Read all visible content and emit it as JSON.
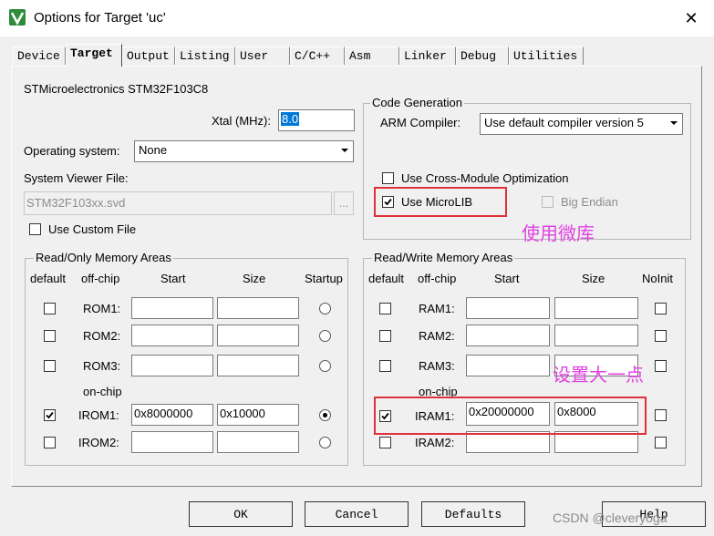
{
  "window": {
    "title": "Options for Target 'uc'",
    "close_glyph": "✕"
  },
  "tabs": [
    "Device",
    "Target",
    "Output",
    "Listing",
    "User",
    "C/C++",
    "Asm",
    "Linker",
    "Debug",
    "Utilities"
  ],
  "active_tab": "Target",
  "device": {
    "name": "STMicroelectronics STM32F103C8"
  },
  "xtal": {
    "label": "Xtal (MHz):",
    "value": "8.0"
  },
  "os": {
    "label": "Operating system:",
    "value": "None"
  },
  "svd": {
    "label": "System Viewer File:",
    "value": "STM32F103xx.svd",
    "browse_label": "..."
  },
  "custom_file": {
    "label": "Use Custom File",
    "checked": false
  },
  "code_gen": {
    "title": "Code Generation",
    "compiler_label": "ARM Compiler:",
    "compiler_value": "Use default compiler version 5",
    "cross_module": {
      "label": "Use Cross-Module Optimization",
      "checked": false
    },
    "microlib": {
      "label": "Use MicroLIB",
      "checked": true
    },
    "big_endian": {
      "label": "Big Endian",
      "checked": false
    }
  },
  "rom": {
    "title": "Read/Only Memory Areas",
    "headers": {
      "default": "default",
      "offchip": "off-chip",
      "start": "Start",
      "size": "Size",
      "startup": "Startup"
    },
    "onchip_label": "on-chip",
    "rows": [
      {
        "name": "ROM1:",
        "start": "",
        "size": "",
        "default": false,
        "startup": false
      },
      {
        "name": "ROM2:",
        "start": "",
        "size": "",
        "default": false,
        "startup": false
      },
      {
        "name": "ROM3:",
        "start": "",
        "size": "",
        "default": false,
        "startup": false
      },
      {
        "name": "IROM1:",
        "start": "0x8000000",
        "size": "0x10000",
        "default": true,
        "startup": true
      },
      {
        "name": "IROM2:",
        "start": "",
        "size": "",
        "default": false,
        "startup": false
      }
    ]
  },
  "ram": {
    "title": "Read/Write Memory Areas",
    "headers": {
      "default": "default",
      "offchip": "off-chip",
      "start": "Start",
      "size": "Size",
      "noinit": "NoInit"
    },
    "onchip_label": "on-chip",
    "rows": [
      {
        "name": "RAM1:",
        "start": "",
        "size": "",
        "default": false,
        "noinit": false
      },
      {
        "name": "RAM2:",
        "start": "",
        "size": "",
        "default": false,
        "noinit": false
      },
      {
        "name": "RAM3:",
        "start": "",
        "size": "",
        "default": false,
        "noinit": false
      },
      {
        "name": "IRAM1:",
        "start": "0x20000000",
        "size": "0x8000",
        "default": true,
        "noinit": false
      },
      {
        "name": "IRAM2:",
        "start": "",
        "size": "",
        "default": false,
        "noinit": false
      }
    ]
  },
  "buttons": {
    "ok": "OK",
    "cancel": "Cancel",
    "defaults": "Defaults",
    "help": "Help"
  },
  "annotations": {
    "microlib_note": "使用微库",
    "iram_note": "设置大一点",
    "color": "#e042e0",
    "box_color": "#e0303a"
  },
  "watermark": "CSDN @cleveryoga"
}
